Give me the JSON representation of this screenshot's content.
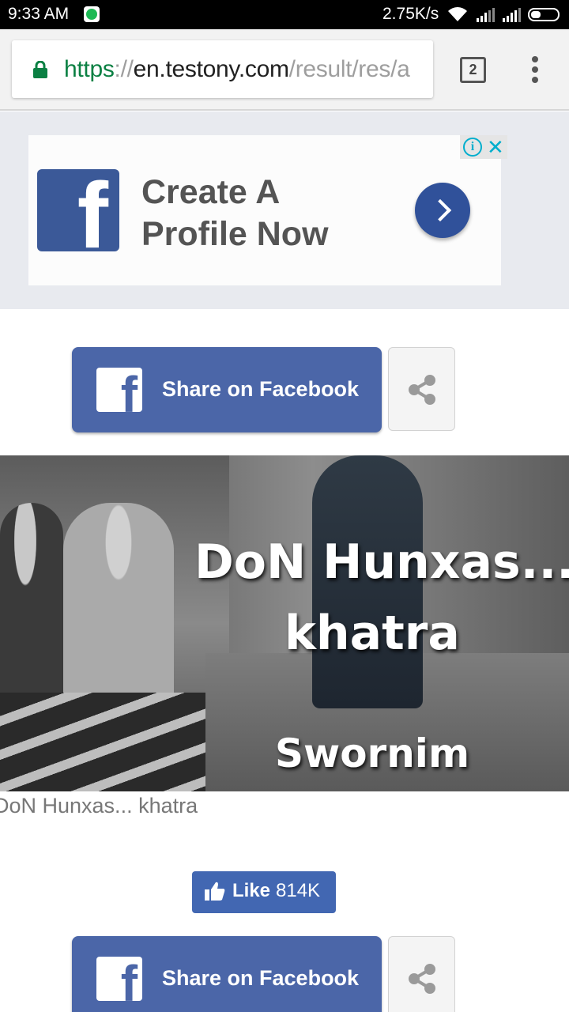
{
  "status_bar": {
    "time": "9:33",
    "ampm": "AM",
    "network_speed": "2.75K/s",
    "icons": [
      "spotify-icon",
      "wifi-icon",
      "signal-icon",
      "signal-icon",
      "battery-icon"
    ]
  },
  "browser": {
    "url_scheme": "https",
    "url_sep": "://",
    "url_host": "en.testony.com",
    "url_path": "/result/res/a",
    "tab_count": "2"
  },
  "ad": {
    "headline_line1": "Create A",
    "headline_line2": "Profile Now",
    "info_icon": "i",
    "close_icon": "✕"
  },
  "share_top": {
    "label": "Share on Facebook",
    "fb_glyph": "f"
  },
  "result": {
    "title_line1": "DoN Hunxas...",
    "title_line2": "khatra",
    "name": "Swornim",
    "caption": "DoN Hunxas... khatra"
  },
  "like": {
    "label": "Like",
    "count": "814K"
  },
  "share_bottom": {
    "label": "Share on Facebook",
    "fb_glyph": "f"
  },
  "colors": {
    "facebook_blue": "#4b66a8",
    "like_blue": "#4267b2",
    "secure_green": "#0b8043",
    "ad_info_cyan": "#00aecd"
  }
}
